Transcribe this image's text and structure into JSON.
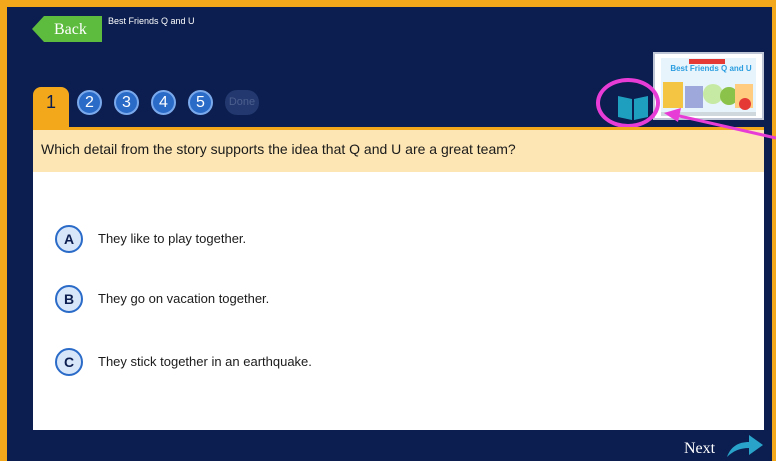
{
  "header": {
    "back_label": "Back",
    "story_title": "Best Friends Q and U"
  },
  "tabs": [
    {
      "label": "1",
      "active": true
    },
    {
      "label": "2"
    },
    {
      "label": "3"
    },
    {
      "label": "4"
    },
    {
      "label": "5"
    },
    {
      "label": "Done",
      "disabled": true
    }
  ],
  "thumbnail": {
    "title": "Best Friends Q and U"
  },
  "question": {
    "text": "Which detail from the story supports the idea that Q and U are a great team?",
    "options": [
      {
        "letter": "A",
        "text": "They like to play together."
      },
      {
        "letter": "B",
        "text": "They go on vacation together."
      },
      {
        "letter": "C",
        "text": "They stick together in an earthquake."
      }
    ]
  },
  "footer": {
    "next_label": "Next"
  },
  "colors": {
    "frame_border": "#f3a81b",
    "background": "#0c1e4f",
    "tab_active": "#f3a81b",
    "tab_number": "#2b6bc8",
    "back_button": "#5dbb3e",
    "question_bar": "#fde6b4",
    "highlight": "#e83cd6",
    "book_icon": "#1f9fc0"
  }
}
